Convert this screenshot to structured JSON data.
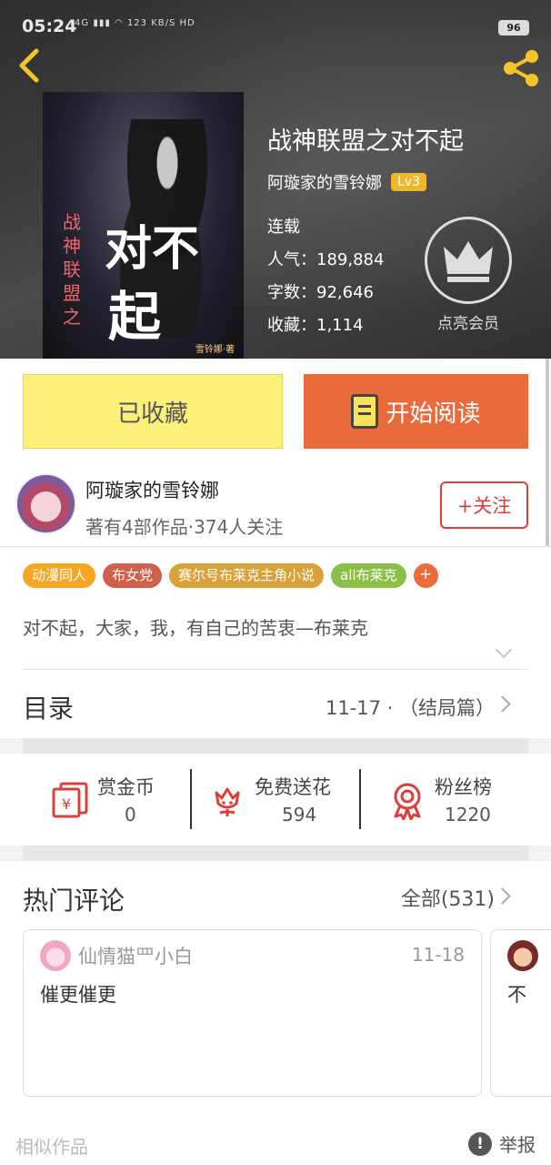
{
  "status_bar": {
    "time": "05:24",
    "network": "4G",
    "speed": "123 KB/S",
    "hd": "HD",
    "battery": "96"
  },
  "book": {
    "title": "战神联盟之对不起",
    "author": "阿璇家的雪铃娜",
    "level": "Lv3",
    "status": "连载",
    "popularity_label": "人气：",
    "popularity": "189,884",
    "words_label": "字数：",
    "words": "92,646",
    "favorites_label": "收藏：",
    "favorites": "1,114",
    "vip_label": "点亮会员",
    "cover_text_big": "对不起",
    "cover_text_small": "战神联盟之",
    "cover_signature": "雪铃娜·著"
  },
  "actions": {
    "favorited_label": "已收藏",
    "read_label": "开始阅读"
  },
  "author_card": {
    "name": "阿璇家的雪铃娜",
    "stats": "著有4部作品·374人关注",
    "follow_label": "+关注"
  },
  "tags": [
    {
      "label": "动漫同人",
      "color": "#f5a623"
    },
    {
      "label": "布女党",
      "color": "#d0604a"
    },
    {
      "label": "赛尔号布莱克主角小说",
      "color": "#d9a13a"
    },
    {
      "label": "all布莱克",
      "color": "#8cbf4a"
    }
  ],
  "tag_more": "+",
  "description": "对不起，大家，我，有自己的苦衷—布莱克",
  "catalog": {
    "title": "目录",
    "latest": "11-17 · （结局篇）"
  },
  "stats": {
    "reward": {
      "name": "赏金币",
      "value": "0"
    },
    "flowers": {
      "name": "免费送花",
      "value": "594"
    },
    "fans": {
      "name": "粉丝榜",
      "value": "1220"
    }
  },
  "comments": {
    "title": "热门评论",
    "all_label": "全部(531)",
    "items": [
      {
        "user": "仙情猫罒小白",
        "date": "11-18",
        "text": "催更催更"
      },
      {
        "user": "",
        "date": "",
        "text": "不"
      }
    ]
  },
  "footer": {
    "similar": "相似作品",
    "report": "举报",
    "report_icon": "!"
  },
  "colors": {
    "accent": "#e96a3b",
    "favorite_btn": "#fbf07a",
    "follow": "#d9403a",
    "level_badge": "#f0b72c"
  }
}
